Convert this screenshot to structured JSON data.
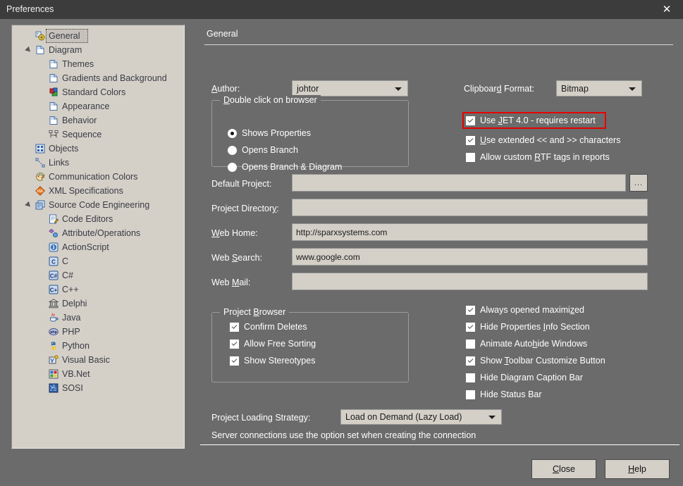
{
  "window": {
    "title": "Preferences",
    "close_icon": "close-icon"
  },
  "tree": {
    "items": [
      {
        "label": "General",
        "icon": "general-gear-icon",
        "indent": 0,
        "selected": true,
        "twisty": false
      },
      {
        "label": "Diagram",
        "icon": "page-icon",
        "indent": 0,
        "selected": false,
        "twisty": true
      },
      {
        "label": "Themes",
        "icon": "page-icon",
        "indent": 1,
        "selected": false,
        "twisty": false
      },
      {
        "label": "Gradients and Background",
        "icon": "page-icon",
        "indent": 1,
        "selected": false,
        "twisty": false
      },
      {
        "label": "Standard Colors",
        "icon": "colors-icon",
        "indent": 1,
        "selected": false,
        "twisty": false
      },
      {
        "label": "Appearance",
        "icon": "page-icon",
        "indent": 1,
        "selected": false,
        "twisty": false
      },
      {
        "label": "Behavior",
        "icon": "page-icon",
        "indent": 1,
        "selected": false,
        "twisty": false
      },
      {
        "label": "Sequence",
        "icon": "sequence-icon",
        "indent": 1,
        "selected": false,
        "twisty": false
      },
      {
        "label": "Objects",
        "icon": "objects-icon",
        "indent": 0,
        "selected": false,
        "twisty": false
      },
      {
        "label": "Links",
        "icon": "links-icon",
        "indent": 0,
        "selected": false,
        "twisty": false
      },
      {
        "label": "Communication Colors",
        "icon": "palette-icon",
        "indent": 0,
        "selected": false,
        "twisty": false
      },
      {
        "label": "XML Specifications",
        "icon": "xml-icon",
        "indent": 0,
        "selected": false,
        "twisty": false
      },
      {
        "label": "Source Code Engineering",
        "icon": "stack-icon",
        "indent": 0,
        "selected": false,
        "twisty": true
      },
      {
        "label": "Code Editors",
        "icon": "editor-icon",
        "indent": 1,
        "selected": false,
        "twisty": false
      },
      {
        "label": "Attribute/Operations",
        "icon": "attribute-icon",
        "indent": 1,
        "selected": false,
        "twisty": false
      },
      {
        "label": "ActionScript",
        "icon": "actionscript-icon",
        "indent": 1,
        "selected": false,
        "twisty": false
      },
      {
        "label": "C",
        "icon": "lang-c-icon",
        "indent": 1,
        "selected": false,
        "twisty": false
      },
      {
        "label": "C#",
        "icon": "lang-csharp-icon",
        "indent": 1,
        "selected": false,
        "twisty": false
      },
      {
        "label": "C++",
        "icon": "lang-cpp-icon",
        "indent": 1,
        "selected": false,
        "twisty": false
      },
      {
        "label": "Delphi",
        "icon": "lang-delphi-icon",
        "indent": 1,
        "selected": false,
        "twisty": false
      },
      {
        "label": "Java",
        "icon": "lang-java-icon",
        "indent": 1,
        "selected": false,
        "twisty": false
      },
      {
        "label": "PHP",
        "icon": "lang-php-icon",
        "indent": 1,
        "selected": false,
        "twisty": false
      },
      {
        "label": "Python",
        "icon": "lang-python-icon",
        "indent": 1,
        "selected": false,
        "twisty": false
      },
      {
        "label": "Visual Basic",
        "icon": "lang-vb-icon",
        "indent": 1,
        "selected": false,
        "twisty": false
      },
      {
        "label": "VB.Net",
        "icon": "lang-vbnet-icon",
        "indent": 1,
        "selected": false,
        "twisty": false
      },
      {
        "label": "SOSI",
        "icon": "lang-sosi-icon",
        "indent": 1,
        "selected": false,
        "twisty": false
      }
    ]
  },
  "page": {
    "tab_title": "General",
    "author_label": "Author:",
    "author_value": "johtor",
    "clipboard_label": "Clipboard Format:",
    "clipboard_value": "Bitmap",
    "double_click_group": "Double click on browser",
    "double_click_options": [
      {
        "label": "Shows Properties",
        "selected": true
      },
      {
        "label": "Opens Branch",
        "selected": false
      },
      {
        "label": "Opens Branch  & Diagram",
        "selected": false
      }
    ],
    "top_checkboxes": [
      {
        "label": "Use JET 4.0 - requires restart",
        "checked": true,
        "highlighted": true
      },
      {
        "label": "Use extended << and >> characters",
        "checked": true,
        "highlighted": false
      },
      {
        "label": "Allow custom RTF tags in reports",
        "checked": false,
        "highlighted": false
      }
    ],
    "fields": [
      {
        "label": "Default Project:",
        "value": "",
        "has_browse": true,
        "browse_label": "..."
      },
      {
        "label": "Project Directory:",
        "value": "",
        "has_browse": false
      },
      {
        "label": "Web Home:",
        "value": "http://sparxsystems.com",
        "has_browse": false
      },
      {
        "label": "Web Search:",
        "value": "www.google.com",
        "has_browse": false
      },
      {
        "label": "Web Mail:",
        "value": "",
        "has_browse": false
      }
    ],
    "project_browser_group": "Project Browser",
    "project_browser_checkboxes": [
      {
        "label": "Confirm Deletes",
        "checked": true
      },
      {
        "label": "Allow Free Sorting",
        "checked": true
      },
      {
        "label": "Show Stereotypes",
        "checked": true
      }
    ],
    "right_checkboxes": [
      {
        "label": "Always opened maximized",
        "checked": true
      },
      {
        "label": "Hide Properties Info Section",
        "checked": true
      },
      {
        "label": "Animate Autohide Windows",
        "checked": false
      },
      {
        "label": "Show Toolbar Customize Button",
        "checked": true
      },
      {
        "label": "Hide Diagram Caption Bar",
        "checked": false
      },
      {
        "label": "Hide Status Bar",
        "checked": false
      }
    ],
    "loading_strategy_label": "Project Loading Strategy:",
    "loading_strategy_value": "Load on Demand (Lazy Load)",
    "server_note": "Server connections use the option set when creating the connection"
  },
  "footer": {
    "close_label": "Close",
    "help_label": "Help"
  },
  "colors": {
    "window_bg": "#6b6b6b",
    "titlebar_bg": "#3c3c3c",
    "panel_bg": "#d4d0c8",
    "highlight": "#e60000",
    "text": "#ffffff"
  }
}
